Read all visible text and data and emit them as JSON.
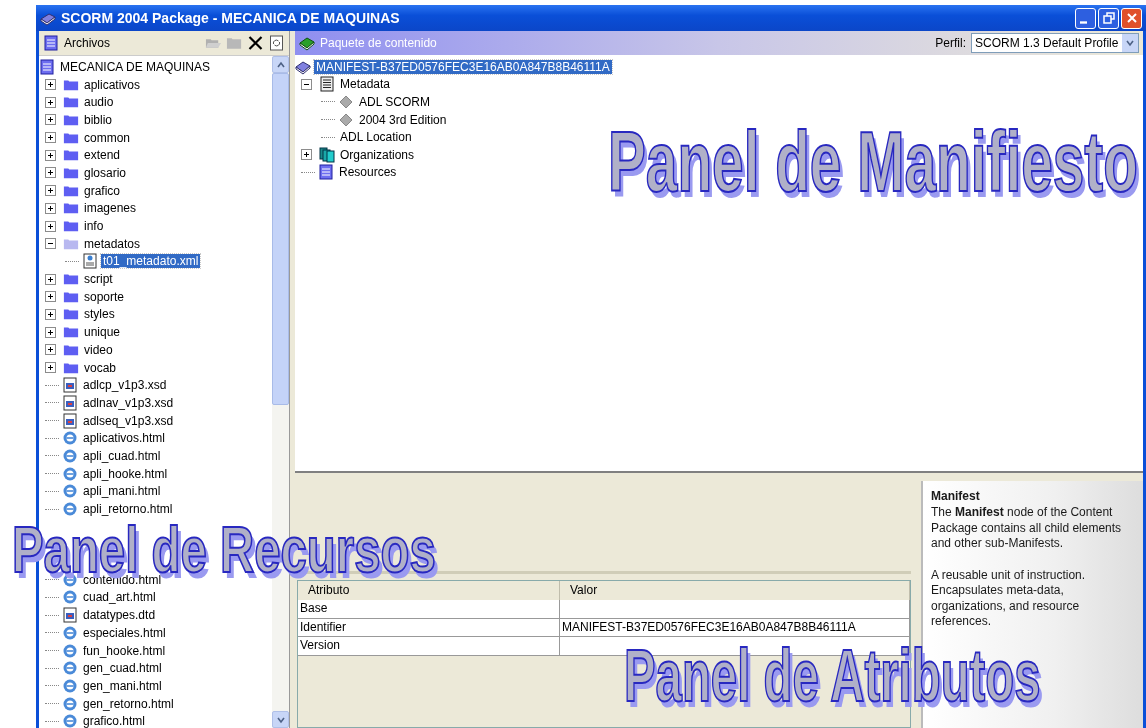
{
  "window": {
    "title": "SCORM 2004 Package - MECANICA DE MAQUINAS"
  },
  "files_panel": {
    "title": "Archivos",
    "root": "MECANICA DE MAQUINAS",
    "items": [
      {
        "label": "aplicativos",
        "kind": "folder",
        "expanded": false,
        "selected": false
      },
      {
        "label": "audio",
        "kind": "folder",
        "expanded": false,
        "selected": false
      },
      {
        "label": "biblio",
        "kind": "folder",
        "expanded": false,
        "selected": false
      },
      {
        "label": "common",
        "kind": "folder",
        "expanded": false,
        "selected": false
      },
      {
        "label": "extend",
        "kind": "folder",
        "expanded": false,
        "selected": false
      },
      {
        "label": "glosario",
        "kind": "folder",
        "expanded": false,
        "selected": false
      },
      {
        "label": "grafico",
        "kind": "folder",
        "expanded": false,
        "selected": false
      },
      {
        "label": "imagenes",
        "kind": "folder",
        "expanded": false,
        "selected": false
      },
      {
        "label": "info",
        "kind": "folder",
        "expanded": false,
        "selected": false
      },
      {
        "label": "metadatos",
        "kind": "folder",
        "expanded": true,
        "selected": false,
        "children": [
          {
            "label": "t01_metadato.xml",
            "kind": "xml",
            "selected": true
          }
        ]
      },
      {
        "label": "script",
        "kind": "folder",
        "expanded": false,
        "selected": false
      },
      {
        "label": "soporte",
        "kind": "folder",
        "expanded": false,
        "selected": false
      },
      {
        "label": "styles",
        "kind": "folder",
        "expanded": false,
        "selected": false
      },
      {
        "label": "unique",
        "kind": "folder",
        "expanded": false,
        "selected": false
      },
      {
        "label": "video",
        "kind": "folder",
        "expanded": false,
        "selected": false
      },
      {
        "label": "vocab",
        "kind": "folder",
        "expanded": false,
        "selected": false
      },
      {
        "label": "adlcp_v1p3.xsd",
        "kind": "schema",
        "selected": false
      },
      {
        "label": "adlnav_v1p3.xsd",
        "kind": "schema",
        "selected": false
      },
      {
        "label": "adlseq_v1p3.xsd",
        "kind": "schema",
        "selected": false
      },
      {
        "label": "aplicativos.html",
        "kind": "html",
        "selected": false
      },
      {
        "label": "apli_cuad.html",
        "kind": "html",
        "selected": false
      },
      {
        "label": "apli_hooke.html",
        "kind": "html",
        "selected": false
      },
      {
        "label": "apli_mani.html",
        "kind": "html",
        "selected": false
      },
      {
        "label": "apli_retorno.html",
        "kind": "html",
        "selected": false
      },
      {
        "kind": "covered"
      },
      {
        "kind": "covered"
      },
      {
        "kind": "covered"
      },
      {
        "label": "contenido.html",
        "kind": "html",
        "selected": false
      },
      {
        "label": "cuad_art.html",
        "kind": "html",
        "selected": false
      },
      {
        "label": "datatypes.dtd",
        "kind": "schema",
        "selected": false
      },
      {
        "label": "especiales.html",
        "kind": "html",
        "selected": false
      },
      {
        "label": "fun_hooke.html",
        "kind": "html",
        "selected": false
      },
      {
        "label": "gen_cuad.html",
        "kind": "html",
        "selected": false
      },
      {
        "label": "gen_mani.html",
        "kind": "html",
        "selected": false
      },
      {
        "label": "gen_retorno.html",
        "kind": "html",
        "selected": false
      },
      {
        "label": "grafico.html",
        "kind": "html",
        "selected": false
      }
    ]
  },
  "manifest_panel": {
    "title": "Paquete de contenido",
    "profile_label": "Perfil:",
    "profile_value": "SCORM 1.3 Default Profile",
    "root": {
      "label": "MANIFEST-B37ED0576FEC3E16AB0A847B8B46111A",
      "selected": true
    },
    "items": [
      {
        "label": "Metadata",
        "kind": "metadata",
        "expanded": true,
        "children": [
          {
            "label": "ADL SCORM",
            "kind": "value"
          },
          {
            "label": "2004 3rd Edition",
            "kind": "value"
          },
          {
            "label": "ADL Location",
            "kind": "plain"
          }
        ]
      },
      {
        "label": "Organizations",
        "kind": "organizations",
        "expanded": false
      },
      {
        "label": "Resources",
        "kind": "resources"
      }
    ]
  },
  "attributes": {
    "columns": [
      "Atributo",
      "Valor"
    ],
    "rows": [
      {
        "name": "Base"
      },
      {
        "name": "Identifier",
        "value": "MANIFEST-B37ED0576FEC3E16AB0A847B8B46111A"
      },
      {
        "name": "Version"
      }
    ]
  },
  "info": {
    "title": "Manifest",
    "paragraphs": [
      "The **Manifest** node of the Content Package contains all child elements and other sub-Manifests.",
      "A reusable unit of instruction. Encapsulates meta-data, organizations, and resource references."
    ]
  },
  "annotations": [
    "Panel de Manifiesto",
    "Panel de Recursos",
    "Panel de Atributos"
  ]
}
